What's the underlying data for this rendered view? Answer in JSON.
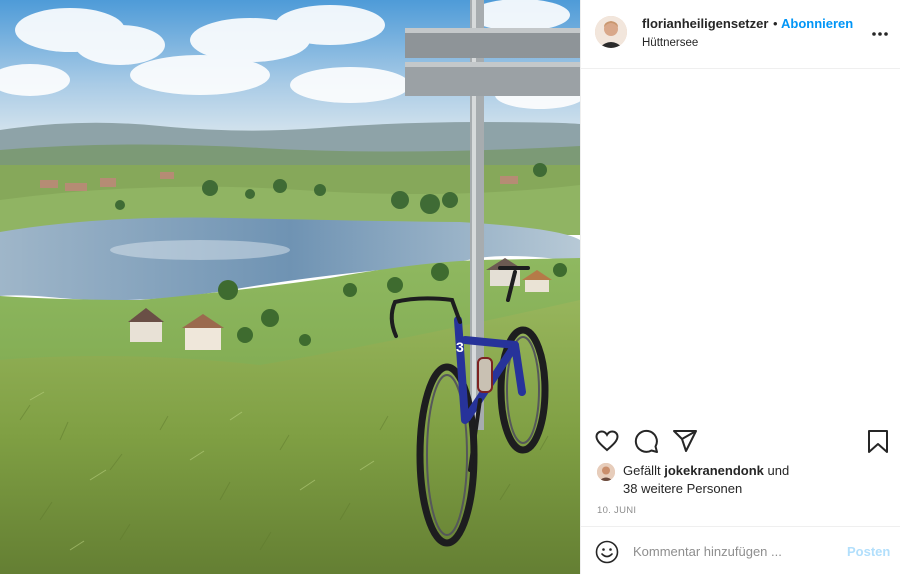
{
  "post": {
    "username": "florianheiligensetzer",
    "separator": "•",
    "follow_label": "Abonnieren",
    "location": "Hüttnersee",
    "more_icon": "more-horizontal-icon"
  },
  "actions": {
    "like_icon": "heart-icon",
    "comment_icon": "comment-icon",
    "share_icon": "paper-plane-icon",
    "save_icon": "bookmark-icon"
  },
  "likes": {
    "prefix": "Gefällt",
    "user": "jokekranendonk",
    "suffix": "und",
    "others": "38 weitere Personen"
  },
  "date": "10. JUNI",
  "comment": {
    "placeholder": "Kommentar hinzufügen ...",
    "post_label": "Posten",
    "emoji_icon": "smiley-icon"
  },
  "colors": {
    "accent": "#0095f6",
    "post_disabled": "#b2dffc",
    "text": "#262626",
    "muted": "#8e8e8e"
  }
}
